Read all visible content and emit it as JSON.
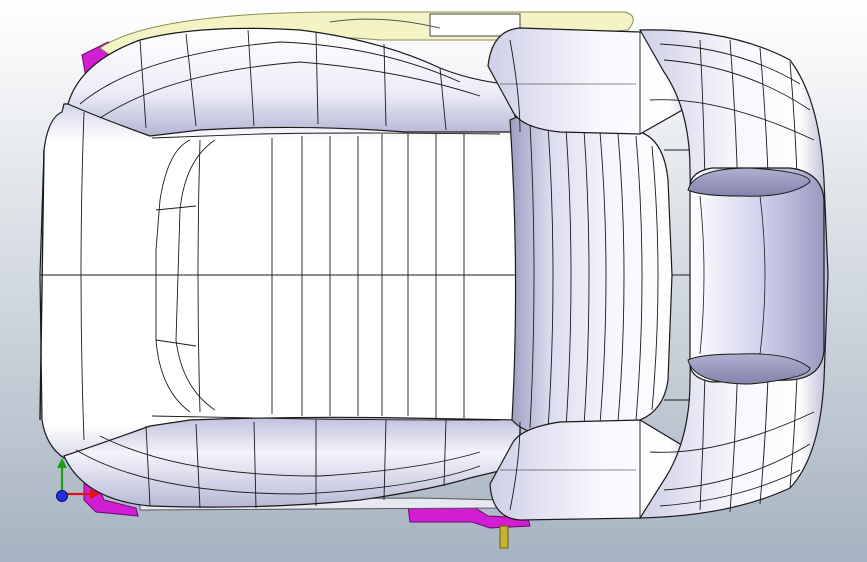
{
  "viewport": {
    "background_top": "#ffffff",
    "background_bottom": "#a7b3c2",
    "model": "car-seat-top-view"
  },
  "colors": {
    "surface_light": "#ffffff",
    "surface_mid": "#e4e4f6",
    "surface_shadow": "#a6a6c4",
    "edge_line": "#1a1a1a",
    "bracket_magenta": "#d21ed2",
    "rail_yellow": "#f4f3c6",
    "rail_outline": "#8f8e50",
    "pin_gold": "#c8b22c"
  },
  "triad": {
    "x_axis_color": "#e01010",
    "y_axis_color": "#18a018",
    "z_axis_color": "#2030e0"
  }
}
